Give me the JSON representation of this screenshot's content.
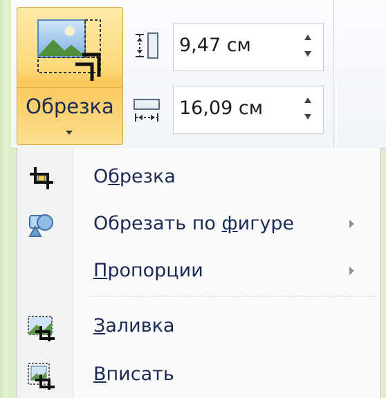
{
  "ribbon": {
    "crop_button": {
      "label": "Обрезка",
      "icon": "crop-picture-icon"
    },
    "height_field": {
      "value": "9,47 см",
      "icon": "shape-height-icon"
    },
    "width_field": {
      "value": "16,09 см",
      "icon": "shape-width-icon"
    }
  },
  "crop_menu": {
    "items": [
      {
        "pre": "О",
        "u": "б",
        "post": "резка",
        "icon": "crop-icon",
        "submenu": false
      },
      {
        "pre": "Обрезать по ",
        "u": "ф",
        "post": "игуре",
        "icon": "crop-to-shape-icon",
        "submenu": true
      },
      {
        "pre": "",
        "u": "П",
        "post": "ропорции",
        "icon": "",
        "submenu": true
      },
      {
        "pre": "",
        "u": "З",
        "post": "аливка",
        "icon": "fill-icon",
        "submenu": false
      },
      {
        "pre": "",
        "u": "В",
        "post": "писать",
        "icon": "fit-icon",
        "submenu": false
      }
    ]
  },
  "colors": {
    "accent": "#fcd97a",
    "text": "#1b2a55",
    "background": "#dfeecb"
  }
}
